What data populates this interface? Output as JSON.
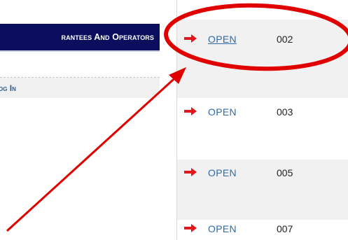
{
  "left_panel": {
    "nav_header": "rantees And Operators",
    "login_link": "og In"
  },
  "table": {
    "rows": [
      {
        "action": "OPEN",
        "number": "002",
        "highlighted": true
      },
      {
        "action": "OPEN",
        "number": "003",
        "highlighted": false
      },
      {
        "action": "OPEN",
        "number": "005",
        "highlighted": false
      },
      {
        "action": "OPEN",
        "number": "007",
        "highlighted": false
      }
    ]
  },
  "colors": {
    "nav_bg": "#0a0e5c",
    "link": "#2f6aa8",
    "arrow": "#e0181b",
    "annotation": "#e00000",
    "row_alt": "#f1f1f1"
  },
  "icons": {
    "row_arrow": "right-arrow-icon"
  }
}
